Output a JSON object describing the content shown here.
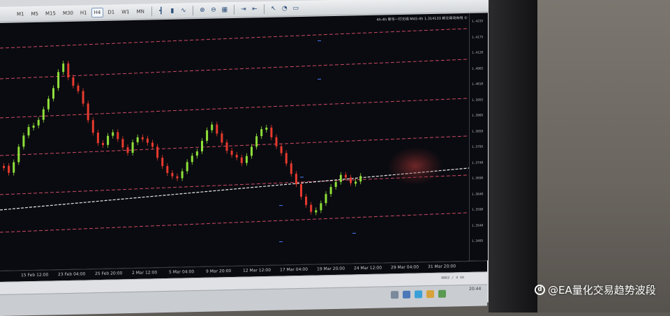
{
  "watermark": {
    "text": "@EA量化交易趋势波段"
  },
  "toolbar": {
    "timeframes": [
      "M1",
      "M5",
      "M15",
      "M30",
      "H1",
      "H4",
      "D1",
      "W1",
      "MN"
    ],
    "active_timeframe": "H4",
    "icons": [
      "bar-chart-icon",
      "candlestick-icon",
      "line-chart-icon",
      "zoom-in-icon",
      "zoom-out-icon",
      "grid-icon",
      "autoscroll-icon",
      "chart-shift-icon",
      "cursor-icon",
      "period-icon",
      "template-icon"
    ]
  },
  "chart": {
    "info_label": "4h-4h  新华一打元线  MA5-4h  1.314133  新交易动向线 ©",
    "price_labels": [
      "1.4235",
      "1.4175",
      "1.4120",
      "1.4065",
      "1.4010",
      "1.3955",
      "1.3905",
      "1.3850",
      "1.3795",
      "1.3740",
      "1.3690",
      "1.3640",
      "1.3590",
      "1.3540",
      "1.3485"
    ],
    "time_labels": [
      "15 Feb 12:00",
      "23 Feb 04:00",
      "25 Feb 20:00",
      "2 Mar 12:00",
      "5 Mar 04:00",
      "9 Mar 20:00",
      "12 Mar 12:00",
      "17 Mar 04:00",
      "19 Mar 20:00",
      "24 Mar 12:00",
      "29 Mar 04:00",
      "31 Mar 20:00"
    ],
    "colors": {
      "up": "#8fe03a",
      "down": "#e83a2e",
      "level": "#ff5a7a",
      "background": "#0a0b10",
      "price_line": "#e8e8e8"
    }
  },
  "statusbar": {
    "text": "4063 / 4 kb"
  },
  "taskbar": {
    "clock": "20:44"
  }
}
